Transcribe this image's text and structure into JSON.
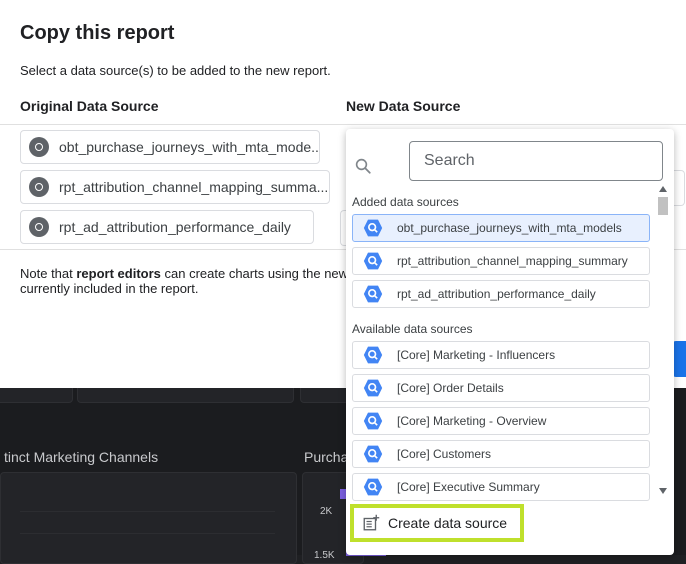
{
  "dialog": {
    "title": "Copy this report",
    "subtitle": "Select a data source(s) to be added to the new report.",
    "col_original": "Original Data Source",
    "col_new": "New Data Source",
    "original_sources": [
      "obt_purchase_journeys_with_mta_mode...",
      "rpt_attribution_channel_mapping_summa...",
      "rpt_ad_attribution_performance_daily"
    ],
    "note_prefix": "Note that ",
    "note_bold": "report editors",
    "note_suffix": " can create charts using the new",
    "note_line2": "currently included in the report."
  },
  "dropdown": {
    "search_placeholder": "Search",
    "added_label": "Added data sources",
    "added": [
      "obt_purchase_journeys_with_mta_models",
      "rpt_attribution_channel_mapping_summary",
      "rpt_ad_attribution_performance_daily"
    ],
    "available_label": "Available data sources",
    "available": [
      "[Core] Marketing - Influencers",
      "[Core] Order Details",
      "[Core] Marketing - Overview",
      "[Core] Customers",
      "[Core] Executive Summary"
    ],
    "create_label": "Create data source"
  },
  "background": {
    "chart1_title": "tinct Marketing Channels",
    "chart2_title": "Purcha",
    "tick_2k": "2K",
    "tick_15k": "1.5K"
  },
  "colors": {
    "accent_highlight": "#bfe02c",
    "bq_blue": "#4285f4",
    "selected_bg": "#e8f0fe"
  }
}
